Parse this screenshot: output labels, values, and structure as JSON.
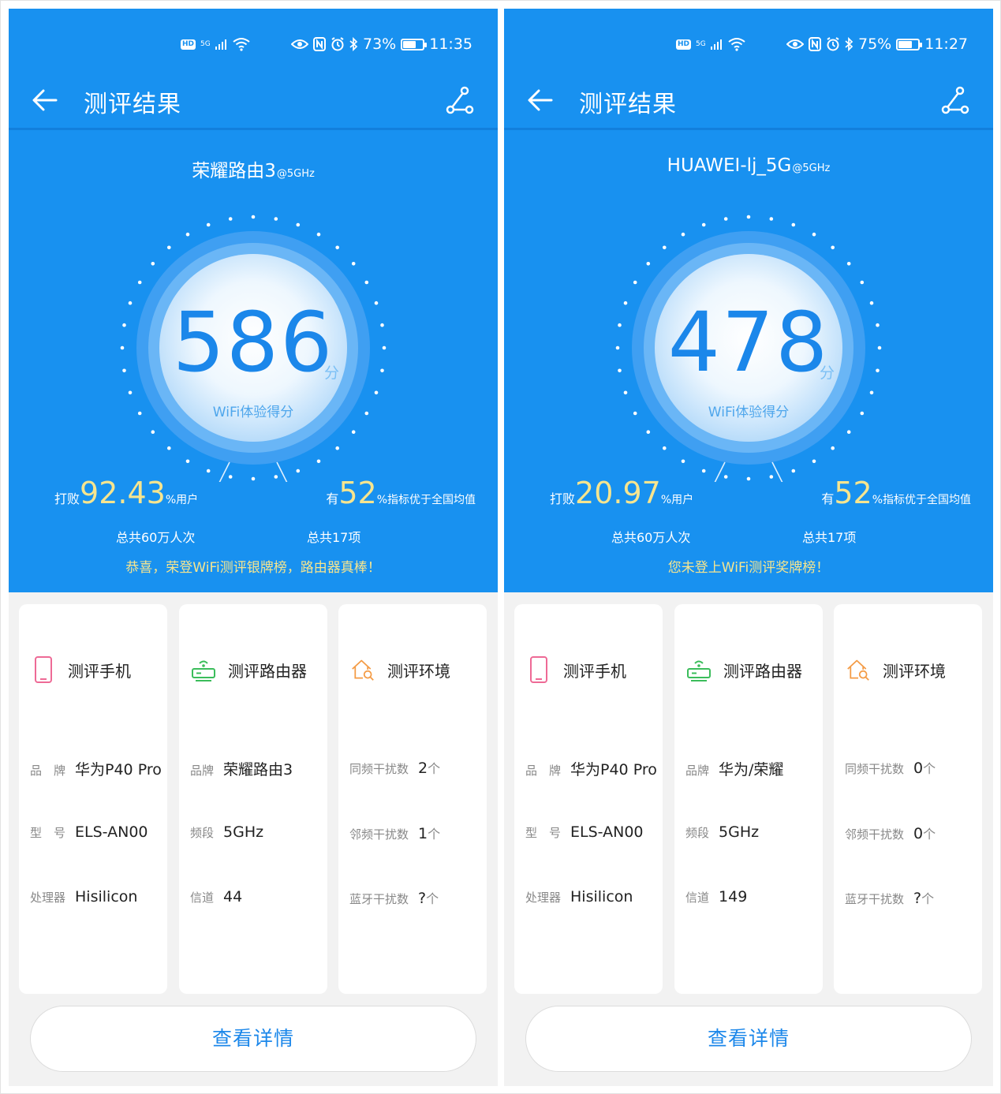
{
  "colors": {
    "header_blue": "#1891f0",
    "score_blue": "#1b87ea",
    "accent_yellow": "#f6e58f",
    "phone_pink": "#ee6a96",
    "router_green": "#3bbd5b",
    "env_orange": "#f49b45"
  },
  "panels": [
    {
      "status": {
        "battery": "73%",
        "battery_level": 0.73,
        "time": "11:35",
        "net": "5G",
        "hd": "HD"
      },
      "toolbar": {
        "title": "测评结果"
      },
      "ssid": {
        "name": "荣耀路由3",
        "band": "@5GHz"
      },
      "score": {
        "value": "586",
        "unit": "分",
        "label": "WiFi体验得分"
      },
      "beat": {
        "prefix": "打败",
        "value": "92.43",
        "suffix": "%用户",
        "total": "总共60万人次"
      },
      "better": {
        "prefix": "有",
        "value": "52",
        "suffix": "%指标优于全国均值",
        "total": "总共17项"
      },
      "message": "恭喜，荣登WiFi测评银牌榜，路由器真棒！",
      "phone_card": {
        "title": "测评手机",
        "rows": [
          {
            "key": "品　牌",
            "value": "华为P40 Pro",
            "unit": ""
          },
          {
            "key": "型　号",
            "value": "ELS-AN00",
            "unit": ""
          },
          {
            "key": "处理器",
            "value": "Hisilicon",
            "unit": ""
          }
        ]
      },
      "router_card": {
        "title": "测评路由器",
        "rows": [
          {
            "key": "品牌",
            "value": "荣耀路由3",
            "unit": ""
          },
          {
            "key": "频段",
            "value": "5GHz",
            "unit": ""
          },
          {
            "key": "信道",
            "value": "44",
            "unit": ""
          }
        ]
      },
      "env_card": {
        "title": "测评环境",
        "rows": [
          {
            "key": "同频干扰数",
            "value": "2",
            "unit": "个"
          },
          {
            "key": "邻频干扰数",
            "value": "1",
            "unit": "个"
          },
          {
            "key": "蓝牙干扰数",
            "value": "?",
            "unit": "个"
          }
        ]
      },
      "detail_button": "查看详情"
    },
    {
      "status": {
        "battery": "75%",
        "battery_level": 0.75,
        "time": "11:27",
        "net": "5G",
        "hd": "HD"
      },
      "toolbar": {
        "title": "测评结果"
      },
      "ssid": {
        "name": "HUAWEI-lj_5G",
        "band": "@5GHz"
      },
      "score": {
        "value": "478",
        "unit": "分",
        "label": "WiFi体验得分"
      },
      "beat": {
        "prefix": "打败",
        "value": "20.97",
        "suffix": "%用户",
        "total": "总共60万人次"
      },
      "better": {
        "prefix": "有",
        "value": "52",
        "suffix": "%指标优于全国均值",
        "total": "总共17项"
      },
      "message": "您未登上WiFi测评奖牌榜！",
      "phone_card": {
        "title": "测评手机",
        "rows": [
          {
            "key": "品　牌",
            "value": "华为P40 Pro",
            "unit": ""
          },
          {
            "key": "型　号",
            "value": "ELS-AN00",
            "unit": ""
          },
          {
            "key": "处理器",
            "value": "Hisilicon",
            "unit": ""
          }
        ]
      },
      "router_card": {
        "title": "测评路由器",
        "rows": [
          {
            "key": "品牌",
            "value": "华为/荣耀",
            "unit": ""
          },
          {
            "key": "频段",
            "value": "5GHz",
            "unit": ""
          },
          {
            "key": "信道",
            "value": "149",
            "unit": ""
          }
        ]
      },
      "env_card": {
        "title": "测评环境",
        "rows": [
          {
            "key": "同频干扰数",
            "value": "0",
            "unit": "个"
          },
          {
            "key": "邻频干扰数",
            "value": "0",
            "unit": "个"
          },
          {
            "key": "蓝牙干扰数",
            "value": "?",
            "unit": "个"
          }
        ]
      },
      "detail_button": "查看详情"
    }
  ]
}
